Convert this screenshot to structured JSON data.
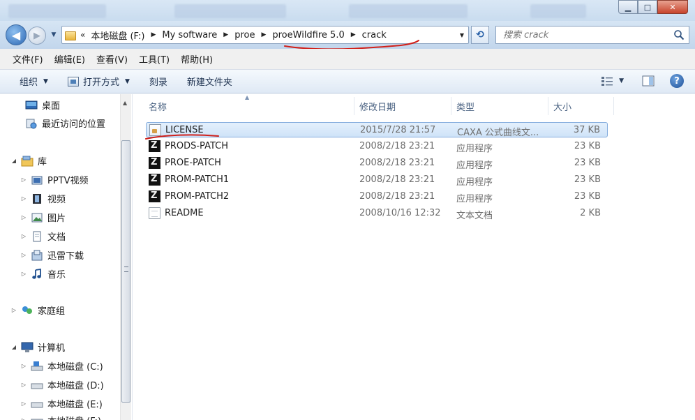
{
  "window": {
    "minimize_glyph": "▁",
    "maximize_glyph": "□",
    "close_glyph": "✕"
  },
  "address_bar": {
    "overflow": "«",
    "breadcrumbs": [
      "本地磁盘 (F:)",
      "My software",
      "proe",
      "proeWildfire 5.0",
      "crack"
    ],
    "separator": "▶",
    "dropdown_glyph": "▼"
  },
  "search": {
    "placeholder": "搜索 crack"
  },
  "menu": [
    "文件(F)",
    "编辑(E)",
    "查看(V)",
    "工具(T)",
    "帮助(H)"
  ],
  "toolbar": {
    "organize": "组织",
    "open_with": "打开方式",
    "burn": "刻录",
    "new_folder": "新建文件夹"
  },
  "nav": {
    "favorites": [
      "桌面",
      "最近访问的位置"
    ],
    "libraries_label": "库",
    "libraries": [
      "PPTV视频",
      "视频",
      "图片",
      "文档",
      "迅雷下载",
      "音乐"
    ],
    "homegroup": "家庭组",
    "computer": "计算机",
    "drives": [
      "本地磁盘 (C:)",
      "本地磁盘 (D:)",
      "本地磁盘 (E:)",
      "本地磁盘 (F:)"
    ]
  },
  "columns": {
    "name": "名称",
    "date": "修改日期",
    "type": "类型",
    "size": "大小"
  },
  "files": [
    {
      "name": "LICENSE",
      "date": "2015/7/28 21:57",
      "type": "CAXA 公式曲线文...",
      "size": "37 KB",
      "icon": "license-file-icon",
      "selected": true
    },
    {
      "name": "PRODS-PATCH",
      "date": "2008/2/18 23:21",
      "type": "应用程序",
      "size": "23 KB",
      "icon": "application-icon"
    },
    {
      "name": "PROE-PATCH",
      "date": "2008/2/18 23:21",
      "type": "应用程序",
      "size": "23 KB",
      "icon": "application-icon"
    },
    {
      "name": "PROM-PATCH1",
      "date": "2008/2/18 23:21",
      "type": "应用程序",
      "size": "23 KB",
      "icon": "application-icon"
    },
    {
      "name": "PROM-PATCH2",
      "date": "2008/2/18 23:21",
      "type": "应用程序",
      "size": "23 KB",
      "icon": "application-icon"
    },
    {
      "name": "README",
      "date": "2008/10/16 12:32",
      "type": "文本文档",
      "size": "2 KB",
      "icon": "text-document-icon"
    }
  ],
  "colors": {
    "annotation_red": "#d0201a",
    "selection_border": "#84acdd",
    "header_text": "#4a6282"
  }
}
